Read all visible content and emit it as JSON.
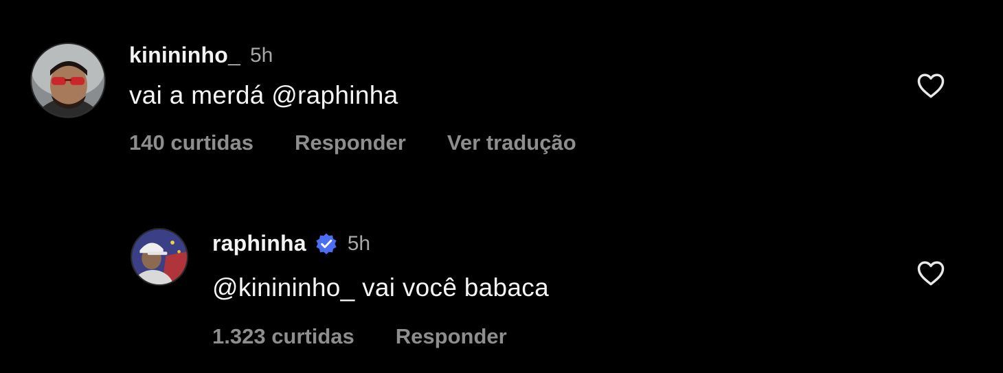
{
  "colors": {
    "background": "#000000",
    "text": "#f5f5f5",
    "muted": "#a8a8a8",
    "action": "#8e8e8e",
    "verified": "#4c6ef5"
  },
  "comments": [
    {
      "username": "kinininho_",
      "time": "5h",
      "text": "vai a merdá @raphinha",
      "likes": "140 curtidas",
      "reply_label": "Responder",
      "translate_label": "Ver tradução",
      "verified": false,
      "like_icon": "heart-outline-icon"
    },
    {
      "username": "raphinha",
      "time": "5h",
      "text": "@kinininho_ vai você babaca",
      "likes": "1.323 curtidas",
      "reply_label": "Responder",
      "verified": true,
      "like_icon": "heart-outline-icon"
    }
  ]
}
